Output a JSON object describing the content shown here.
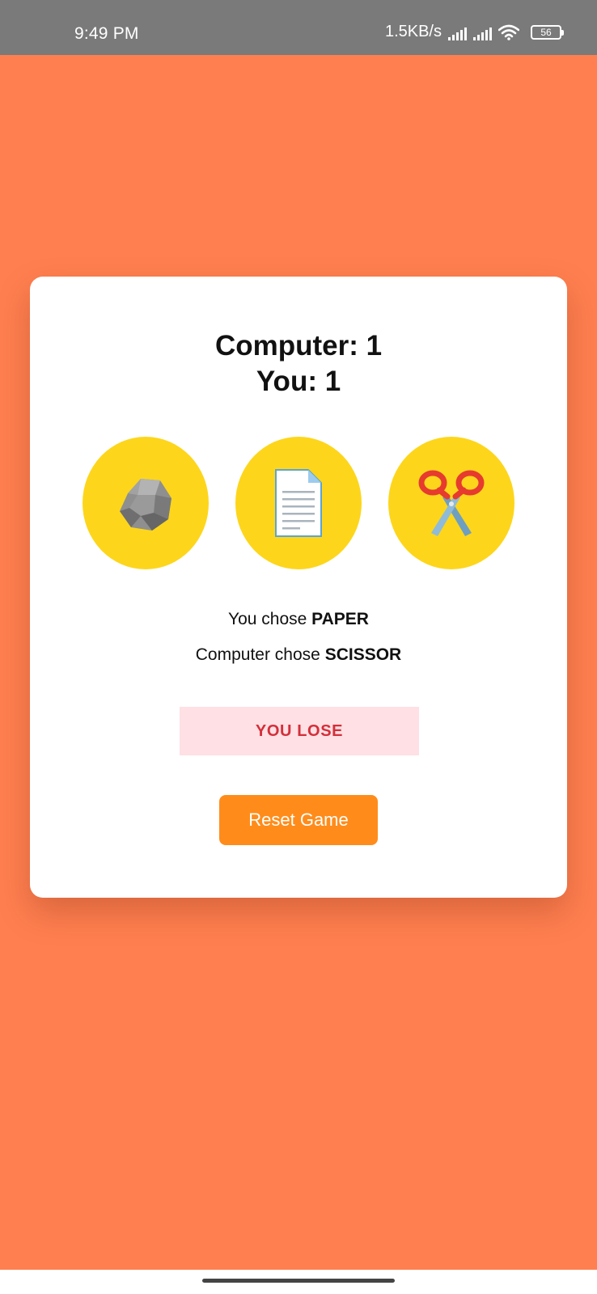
{
  "colors": {
    "status_bar_bg": "#7a7a7a",
    "app_bg": "#ff7f50",
    "choice_circle": "#fdd61b",
    "outcome_bg": "#ffe0e4",
    "outcome_text": "#d32f3a",
    "button_bg": "#ff8c1a"
  },
  "status_bar": {
    "time": "9:49 PM",
    "net_speed": "1.5KB/s",
    "battery": "56",
    "icons": [
      "signal-icon",
      "signal-icon",
      "wifi-icon",
      "battery-icon"
    ]
  },
  "score": {
    "computer_label": "Computer: 1",
    "you_label": "You: 1"
  },
  "choices": [
    {
      "name": "rock",
      "icon": "rock-icon"
    },
    {
      "name": "paper",
      "icon": "paper-icon"
    },
    {
      "name": "scissors",
      "icon": "scissors-icon"
    }
  ],
  "result": {
    "you_prefix": "You chose ",
    "you_choice": "PAPER",
    "computer_prefix": "Computer chose ",
    "computer_choice": "SCISSOR"
  },
  "outcome": "YOU LOSE",
  "reset_label": "Reset Game"
}
